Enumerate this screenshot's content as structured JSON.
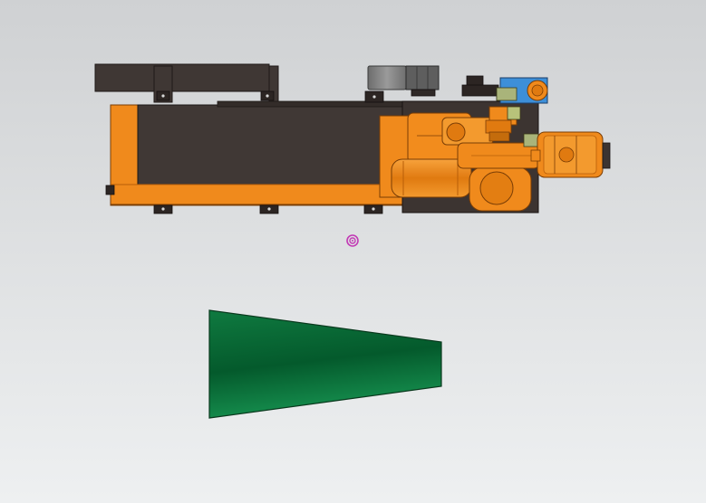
{
  "scene": {
    "background_top": "#cfd1d3",
    "background_bottom": "#eef0f1",
    "colors": {
      "machine_orange": "#f08a1c",
      "machine_orange_dark": "#b85e08",
      "frame_dark": "#403835",
      "frame_darker": "#2a2422",
      "gearbox_grey": "#808080",
      "motor_blue": "#3d8fd8",
      "accent_green": "#a9b47a",
      "panel_green": "#0b6b38",
      "panel_green_light": "#14904e",
      "origin_marker": "#c23bb5"
    },
    "objects": [
      {
        "name": "conveyor-beam"
      },
      {
        "name": "robot-arm"
      },
      {
        "name": "gearbox"
      },
      {
        "name": "drive-motor"
      },
      {
        "name": "end-effector"
      },
      {
        "name": "origin-marker-icon"
      },
      {
        "name": "work-panel"
      }
    ]
  }
}
